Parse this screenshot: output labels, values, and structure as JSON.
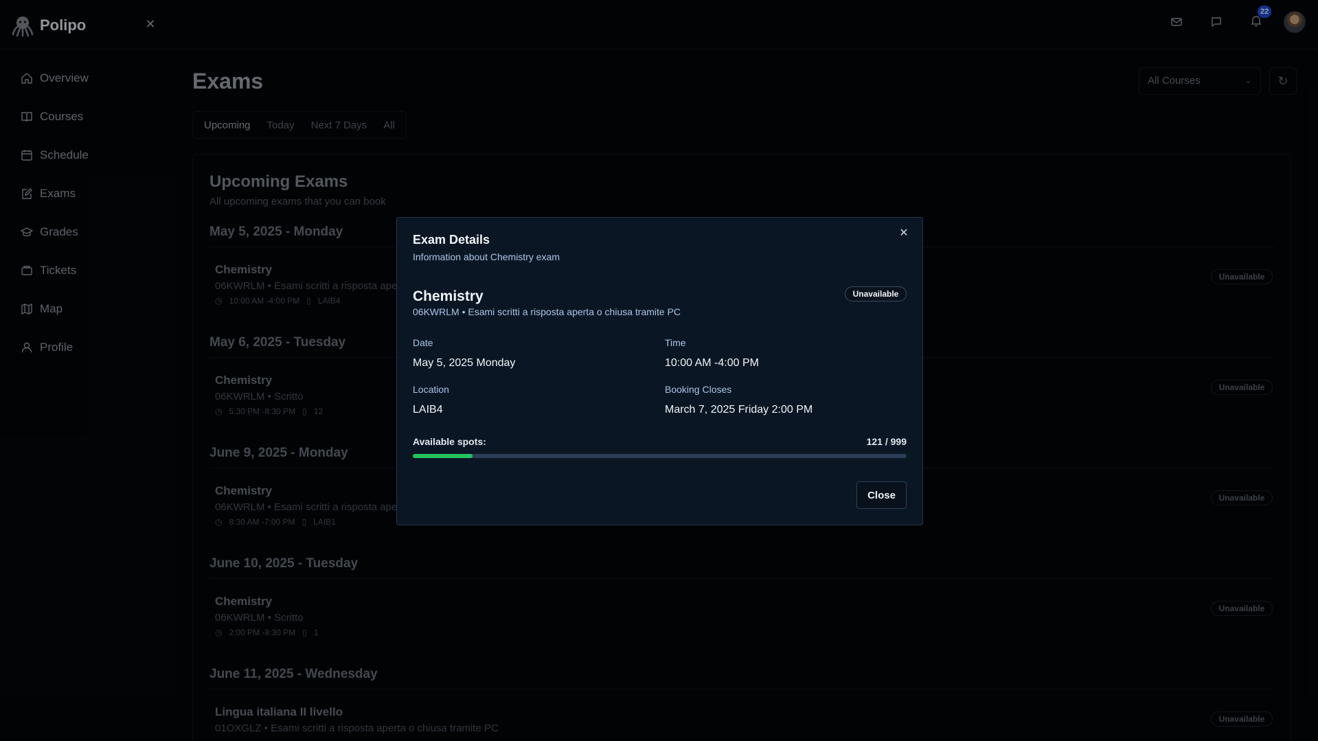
{
  "app": {
    "name": "Polipo"
  },
  "header": {
    "notification_count": "22"
  },
  "sidebar": {
    "items": [
      {
        "label": "Overview",
        "icon": "home-icon"
      },
      {
        "label": "Courses",
        "icon": "book-icon"
      },
      {
        "label": "Schedule",
        "icon": "calendar-icon"
      },
      {
        "label": "Exams",
        "icon": "edit-icon"
      },
      {
        "label": "Grades",
        "icon": "graduation-cap-icon"
      },
      {
        "label": "Tickets",
        "icon": "ticket-icon"
      },
      {
        "label": "Map",
        "icon": "map-icon"
      },
      {
        "label": "Profile",
        "icon": "user-icon"
      }
    ]
  },
  "page": {
    "title": "Exams",
    "course_filter": "All Courses",
    "tabs": [
      "Upcoming",
      "Today",
      "Next 7 Days",
      "All"
    ],
    "active_tab": "Upcoming"
  },
  "list": {
    "title": "Upcoming Exams",
    "subtitle": "All upcoming exams that you can book",
    "groups": [
      {
        "date": "May 5, 2025 - Monday",
        "exam": {
          "name": "Chemistry",
          "desc": "06KWRLM • Esami scritti a risposta ape",
          "time": "10:00 AM -4:00 PM",
          "room": "LAIB4",
          "status": "Unavailable"
        }
      },
      {
        "date": "May 6, 2025 - Tuesday",
        "exam": {
          "name": "Chemistry",
          "desc": "06KWRLM • Scritto",
          "time": "5:30 PM -8:30 PM",
          "room": "12",
          "status": "Unavailable"
        }
      },
      {
        "date": "June 9, 2025 - Monday",
        "exam": {
          "name": "Chemistry",
          "desc": "06KWRLM • Esami scritti a risposta ape",
          "time": "8:30 AM -7:00 PM",
          "room": "LAIB1",
          "status": "Unavailable"
        }
      },
      {
        "date": "June 10, 2025 - Tuesday",
        "exam": {
          "name": "Chemistry",
          "desc": "06KWRLM • Scritto",
          "time": "2:00 PM -8:30 PM",
          "room": "1",
          "status": "Unavailable"
        }
      },
      {
        "date": "June 11, 2025 - Wednesday",
        "exam": {
          "name": "Lingua italiana II livello",
          "desc": "01OXGLZ • Esami scritti a risposta aperta o chiusa tramite PC",
          "time": "",
          "room": "",
          "status": "Unavailable"
        }
      }
    ]
  },
  "modal": {
    "title": "Exam Details",
    "subtitle": "Information about Chemistry exam",
    "exam_name": "Chemistry",
    "exam_desc": "06KWRLM • Esami scritti a risposta aperta o chiusa tramite PC",
    "status": "Unavailable",
    "date_label": "Date",
    "date_value": "May 5, 2025 Monday",
    "time_label": "Time",
    "time_value": "10:00 AM -4:00 PM",
    "location_label": "Location",
    "location_value": "LAIB4",
    "booking_label": "Booking Closes",
    "booking_value": "March 7, 2025 Friday 2:00 PM",
    "spots_label": "Available spots:",
    "spots_value": "121 / 999",
    "spots_fraction": 0.121,
    "close_label": "Close"
  },
  "colors": {
    "progress": "#22c55e",
    "badge": "#1d4ed8"
  }
}
